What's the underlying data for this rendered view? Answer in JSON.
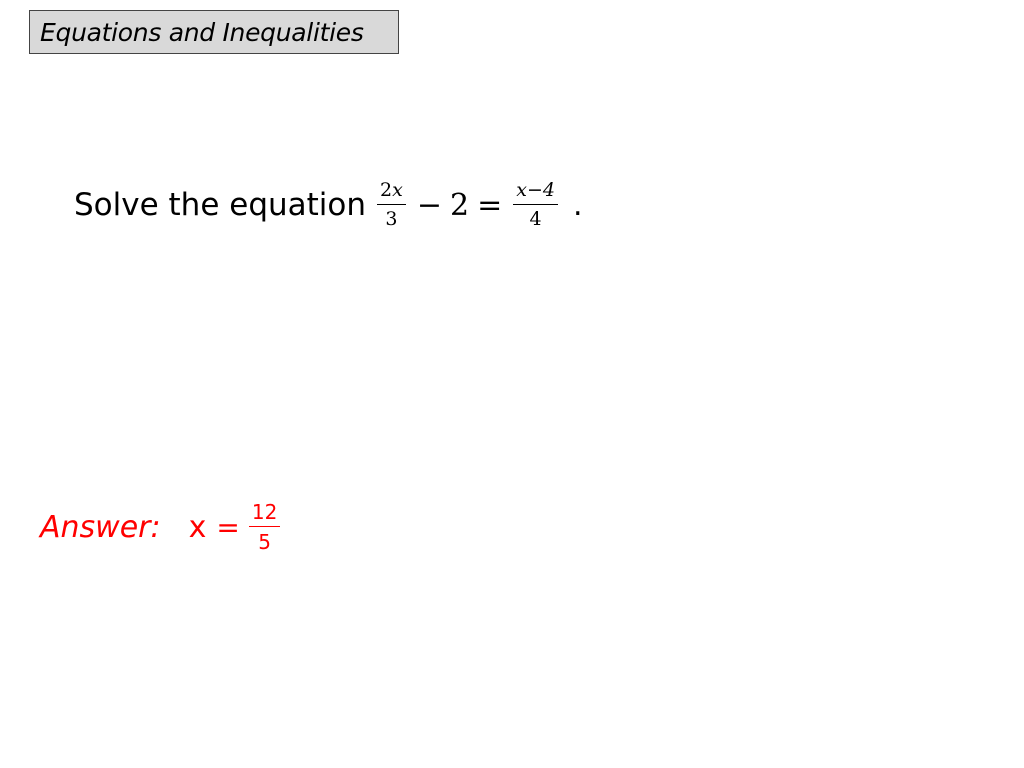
{
  "header": {
    "title": "Equations and Inequalities"
  },
  "question": {
    "prompt": "Solve the equation",
    "equation": {
      "lhs_fraction": {
        "numerator_coeff": "2",
        "numerator_var": "x",
        "denominator": "3"
      },
      "minus": "−",
      "constant": "2",
      "equals": "=",
      "rhs_fraction": {
        "numerator": "x−4",
        "denominator": "4"
      }
    },
    "trailing": "."
  },
  "answer": {
    "label": "Answer:",
    "variable": "x",
    "equals": "=",
    "fraction": {
      "numerator": "12",
      "denominator": "5"
    },
    "color": "#ff0000"
  }
}
